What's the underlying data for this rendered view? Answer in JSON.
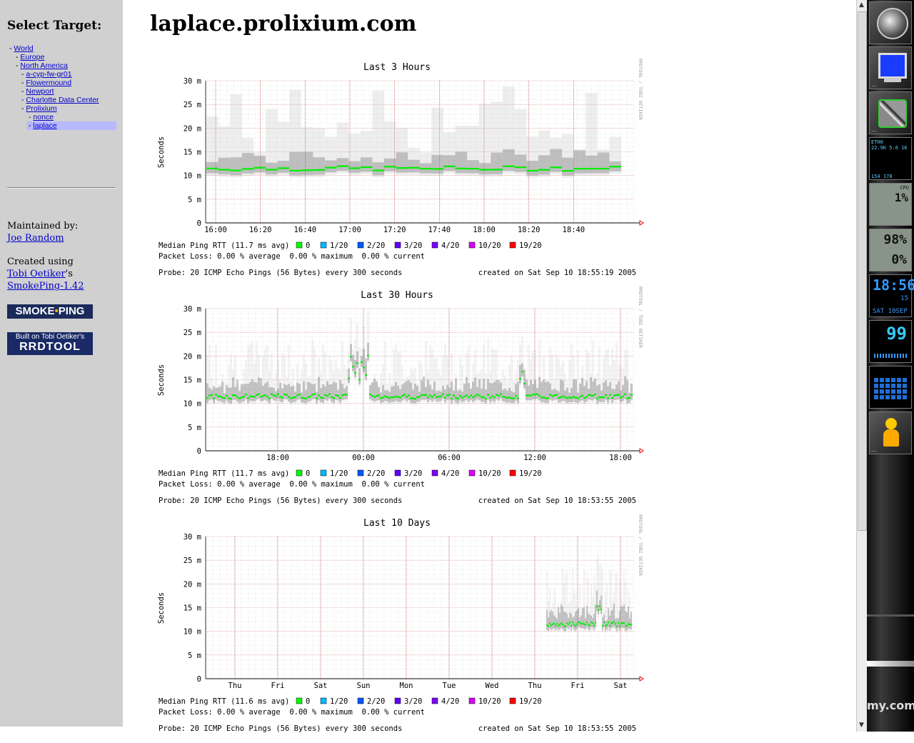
{
  "sidebar": {
    "heading": "Select Target:",
    "tree": [
      {
        "prefix": "- ",
        "label": "World"
      },
      {
        "prefix": "- ",
        "label": "Europe"
      },
      {
        "prefix": "- ",
        "label": "North America"
      },
      {
        "prefix": "- ",
        "label": "a-cyp-fw-gr01"
      },
      {
        "prefix": "- ",
        "label": "Flowermound"
      },
      {
        "prefix": "- ",
        "label": "Newport"
      },
      {
        "prefix": "- ",
        "label": "Charlotte Data Center"
      },
      {
        "prefix": "- ",
        "label": "Prolixium"
      },
      {
        "prefix": "- ",
        "label": "nonce"
      },
      {
        "prefix": "- ",
        "label": "laplace"
      }
    ],
    "maintained_label": "Maintained by:",
    "maintainer": "Joe Random",
    "created_label": "Created using",
    "author": "Tobi Oetiker",
    "author_suffix": "'s",
    "software": "SmokePing-1.42",
    "logo_smoke": "SMOKE",
    "logo_dot": "•",
    "logo_ping": "PING",
    "logo_rrd_top": "Built on Tobi Oetiker's",
    "logo_rrd_bottom": "RRDTOOL"
  },
  "page": {
    "title": "laplace.prolixium.com"
  },
  "graphs": [
    {
      "title": "Last 3 Hours",
      "ylabel": "Seconds",
      "side_label": "RRDTOOL / TOBI OETIKER",
      "yticks": [
        "30 m",
        "25 m",
        "20 m",
        "15 m",
        "10 m",
        "5 m",
        "0"
      ],
      "xticks": [
        "16:00",
        "16:20",
        "16:40",
        "17:00",
        "17:20",
        "17:40",
        "18:00",
        "18:20",
        "18:40"
      ],
      "median_text": "Median Ping RTT (11.7 ms avg)",
      "loss_text": "Packet Loss: 0.00 % average  0.00 % maximum  0.00 % current",
      "probe_text": "Probe: 20 ICMP Echo Pings (56 Bytes) every 300 seconds",
      "created_text": "created on Sat Sep 10 18:55:19 2005"
    },
    {
      "title": "Last 30 Hours",
      "ylabel": "Seconds",
      "side_label": "RRDTOOL / TOBI OETIKER",
      "yticks": [
        "30 m",
        "25 m",
        "20 m",
        "15 m",
        "10 m",
        "5 m",
        "0"
      ],
      "xticks": [
        "18:00",
        "00:00",
        "06:00",
        "12:00",
        "18:00"
      ],
      "median_text": "Median Ping RTT (11.7 ms avg)",
      "loss_text": "Packet Loss: 0.00 % average  0.00 % maximum  0.00 % current",
      "probe_text": "Probe: 20 ICMP Echo Pings (56 Bytes) every 300 seconds",
      "created_text": "created on Sat Sep 10 18:53:55 2005"
    },
    {
      "title": "Last 10 Days",
      "ylabel": "Seconds",
      "side_label": "RRDTOOL / TOBI OETIKER",
      "yticks": [
        "30 m",
        "25 m",
        "20 m",
        "15 m",
        "10 m",
        "5 m",
        "0"
      ],
      "xticks": [
        "Thu",
        "Fri",
        "Sat",
        "Sun",
        "Mon",
        "Tue",
        "Wed",
        "Thu",
        "Fri",
        "Sat"
      ],
      "median_text": "Median Ping RTT (11.6 ms avg)",
      "loss_text": "Packet Loss: 0.00 % average  0.00 % maximum  0.00 % current",
      "probe_text": "Probe: 20 ICMP Echo Pings (56 Bytes) every 300 seconds",
      "created_text": "created on Sat Sep 10 18:53:55 2005"
    }
  ],
  "legend": [
    {
      "label": "0",
      "color": "#00ff00"
    },
    {
      "label": "1/20",
      "color": "#00b8ff"
    },
    {
      "label": "2/20",
      "color": "#0059ff"
    },
    {
      "label": "3/20",
      "color": "#5e00ff"
    },
    {
      "label": "4/20",
      "color": "#7e00ff"
    },
    {
      "label": "10/20",
      "color": "#dd00ff"
    },
    {
      "label": "19/20",
      "color": "#ff0000"
    }
  ],
  "chart_data": [
    {
      "type": "area",
      "title": "Last 3 Hours",
      "ylabel": "Seconds",
      "ylim_ms": [
        0,
        30
      ],
      "x": [
        "16:00",
        "16:20",
        "16:40",
        "17:00",
        "17:20",
        "17:40",
        "18:00",
        "18:20",
        "18:40"
      ],
      "series": [
        {
          "name": "Median Ping RTT",
          "values_ms": [
            11.7,
            12.0,
            12.2,
            12.3,
            11.8,
            11.9,
            11.9,
            12.1,
            11.7
          ]
        }
      ]
    },
    {
      "type": "area",
      "title": "Last 30 Hours",
      "ylabel": "Seconds",
      "ylim_ms": [
        0,
        30
      ],
      "x": [
        "18:00",
        "00:00",
        "06:00",
        "12:00",
        "18:00"
      ],
      "series": [
        {
          "name": "Median Ping RTT",
          "values_ms": [
            11.7,
            16.5,
            11.6,
            11.8,
            11.8
          ]
        }
      ]
    },
    {
      "type": "area",
      "title": "Last 10 Days",
      "ylabel": "Seconds",
      "ylim_ms": [
        0,
        30
      ],
      "x": [
        "Thu",
        "Fri",
        "Sat",
        "Sun",
        "Mon",
        "Tue",
        "Wed",
        "Thu",
        "Fri",
        "Sat"
      ],
      "series": [
        {
          "name": "Median Ping RTT",
          "values_ms": [
            null,
            null,
            null,
            null,
            null,
            null,
            null,
            11.5,
            11.8,
            12.0
          ]
        }
      ]
    }
  ],
  "dock": {
    "net_label": "ETH0",
    "net_rates": "22.9K 5.6 1K",
    "net_totals": "154  178",
    "cpu_label": "CPU",
    "cpu_value": "1%",
    "mem_value": "98%",
    "swap_value": "0%",
    "clock_time": "18:56",
    "clock_date": "SAT 10SEP",
    "clock_sec": "15",
    "signal_value": "99",
    "footer_text": "my.com"
  }
}
